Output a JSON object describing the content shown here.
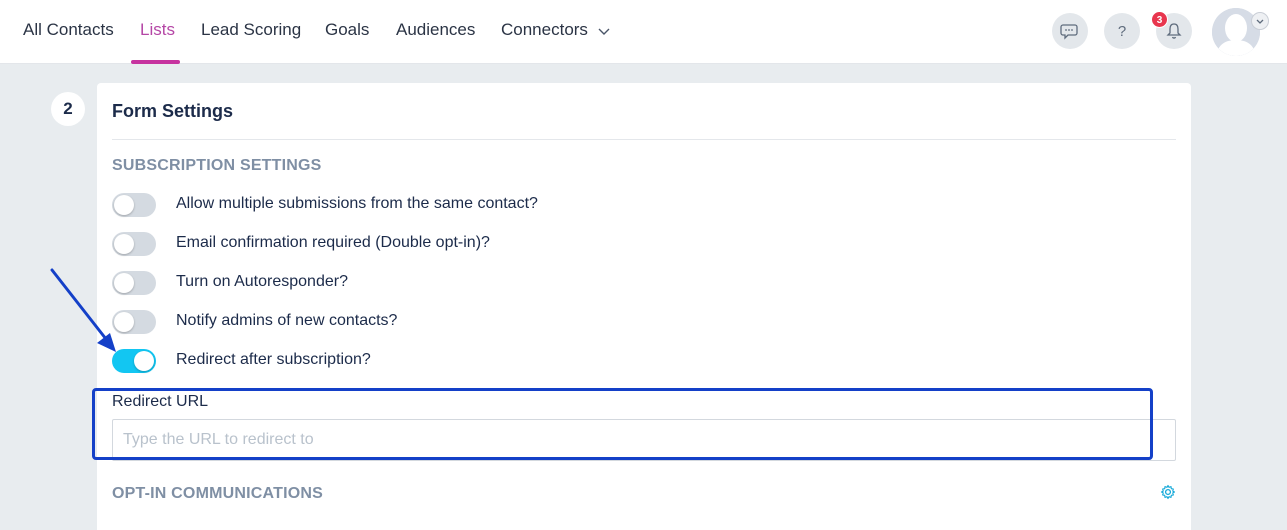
{
  "nav": {
    "items": [
      {
        "label": "All Contacts",
        "active": false
      },
      {
        "label": "Lists",
        "active": true
      },
      {
        "label": "Lead Scoring",
        "active": false
      },
      {
        "label": "Goals",
        "active": false
      },
      {
        "label": "Audiences",
        "active": false
      },
      {
        "label": "Connectors",
        "active": false,
        "has_dropdown": true
      }
    ],
    "help_label": "?",
    "notification_count": "3",
    "icons": [
      "chat-icon",
      "help-icon",
      "bell-icon",
      "avatar",
      "chevron-down-icon"
    ]
  },
  "step": {
    "number": "2"
  },
  "form_settings": {
    "title": "Form Settings",
    "subscription_heading": "SUBSCRIPTION SETTINGS",
    "toggles": [
      {
        "label": "Allow multiple submissions from the same contact?",
        "on": false
      },
      {
        "label": "Email confirmation required (Double opt-in)?",
        "on": false
      },
      {
        "label": "Turn on Autoresponder?",
        "on": false
      },
      {
        "label": "Notify admins of new contacts?",
        "on": false
      },
      {
        "label": "Redirect after subscription?",
        "on": true
      }
    ],
    "redirect_url": {
      "label": "Redirect URL",
      "value": "",
      "placeholder": "Type the URL to redirect to"
    },
    "optin_heading": "OPT-IN COMMUNICATIONS"
  },
  "colors": {
    "accent_active_tab": "#c6339f",
    "toggle_on": "#12c6f2",
    "toggle_off": "#d4dae1",
    "annotation": "#1440c8",
    "badge": "#e8364e"
  }
}
